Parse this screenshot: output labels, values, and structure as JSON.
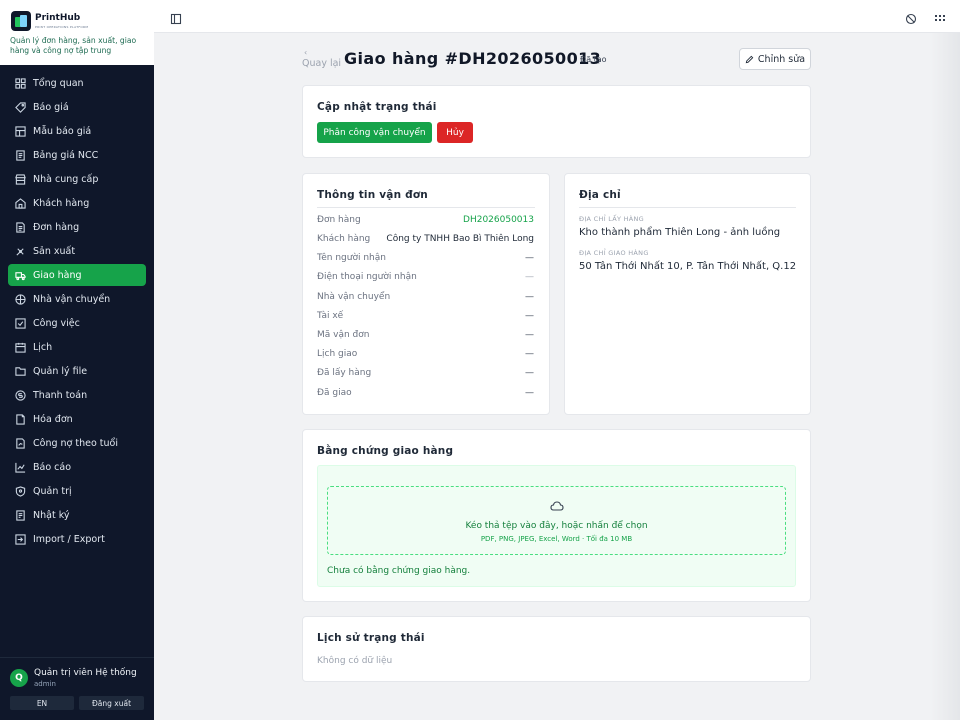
{
  "brand": {
    "name": "PrintHub",
    "tagline": "PRINT OPERATIONS PLATFORM",
    "description": "Quản lý đơn hàng, sản xuất, giao hàng và công nợ tập trung"
  },
  "sidebar": {
    "items": [
      {
        "label": "Tổng quan",
        "icon": "dashboard-icon"
      },
      {
        "label": "Báo giá",
        "icon": "tag-icon"
      },
      {
        "label": "Mẫu báo giá",
        "icon": "template-icon"
      },
      {
        "label": "Bảng giá NCC",
        "icon": "price-list-icon"
      },
      {
        "label": "Nhà cung cấp",
        "icon": "supplier-icon"
      },
      {
        "label": "Khách hàng",
        "icon": "customers-icon"
      },
      {
        "label": "Đơn hàng",
        "icon": "orders-icon"
      },
      {
        "label": "Sản xuất",
        "icon": "production-icon"
      },
      {
        "label": "Giao hàng",
        "icon": "delivery-icon",
        "active": true
      },
      {
        "label": "Nhà vận chuyển",
        "icon": "carrier-icon"
      },
      {
        "label": "Công việc",
        "icon": "tasks-icon"
      },
      {
        "label": "Lịch",
        "icon": "calendar-icon"
      },
      {
        "label": "Quản lý file",
        "icon": "folder-icon"
      },
      {
        "label": "Thanh toán",
        "icon": "payment-icon"
      },
      {
        "label": "Hóa đơn",
        "icon": "invoice-icon"
      },
      {
        "label": "Công nợ theo tuổi",
        "icon": "debt-aging-icon"
      },
      {
        "label": "Báo cáo",
        "icon": "report-icon"
      },
      {
        "label": "Quản trị",
        "icon": "admin-shield-icon"
      },
      {
        "label": "Nhật ký",
        "icon": "log-icon"
      },
      {
        "label": "Import / Export",
        "icon": "import-export-icon"
      }
    ]
  },
  "user": {
    "initial": "Q",
    "name": "Quản trị viên Hệ thống",
    "role": "admin",
    "lang_button": "EN",
    "logout_button": "Đăng xuất"
  },
  "header": {
    "back_label": "Quay lại",
    "title": "Giao hàng #DH2026050013",
    "status": "Đã tạo",
    "edit_label": "Chỉnh sửa"
  },
  "status_card": {
    "title": "Cập nhật trạng thái",
    "assign_label": "Phân công vận chuyển",
    "cancel_label": "Hủy"
  },
  "shipment": {
    "title": "Thông tin vận đơn",
    "rows": [
      {
        "label": "Đơn hàng",
        "value": "DH2026050013"
      },
      {
        "label": "Khách hàng",
        "value": "Công ty TNHH Bao Bì Thiên Long"
      },
      {
        "label": "Tên người nhận",
        "value": "—"
      },
      {
        "label": "Điện thoại người nhận",
        "value": "—"
      },
      {
        "label": "Nhà vận chuyển",
        "value": "—"
      },
      {
        "label": "Tài xế",
        "value": "—"
      },
      {
        "label": "Mã vận đơn",
        "value": "—"
      },
      {
        "label": "Lịch giao",
        "value": "—"
      },
      {
        "label": "Đã lấy hàng",
        "value": "—"
      },
      {
        "label": "Đã giao",
        "value": "—"
      }
    ]
  },
  "address": {
    "title": "Địa chỉ",
    "pickup_label": "Địa chỉ lấy hàng",
    "pickup_value": "Kho thành phẩm Thiên Long - ảnh luồng",
    "delivery_label": "Địa chỉ giao hàng",
    "delivery_value": "50 Tân Thới Nhất 10, P. Tân Thới Nhất, Q.12"
  },
  "proof": {
    "title": "Bằng chứng giao hàng",
    "drop_text": "Kéo thả tệp vào đây, hoặc nhấn để chọn",
    "drop_hint": "PDF, PNG, JPEG, Excel, Word · Tối đa 10 MB",
    "empty_text": "Chưa có bằng chứng giao hàng."
  },
  "history": {
    "title": "Lịch sử trạng thái",
    "empty_text": "Không có dữ liệu"
  },
  "colors": {
    "sidebar_bg": "#0f172a",
    "accent_green": "#16a34a",
    "danger_red": "#dc2626",
    "page_bg": "#f1f2f4"
  }
}
